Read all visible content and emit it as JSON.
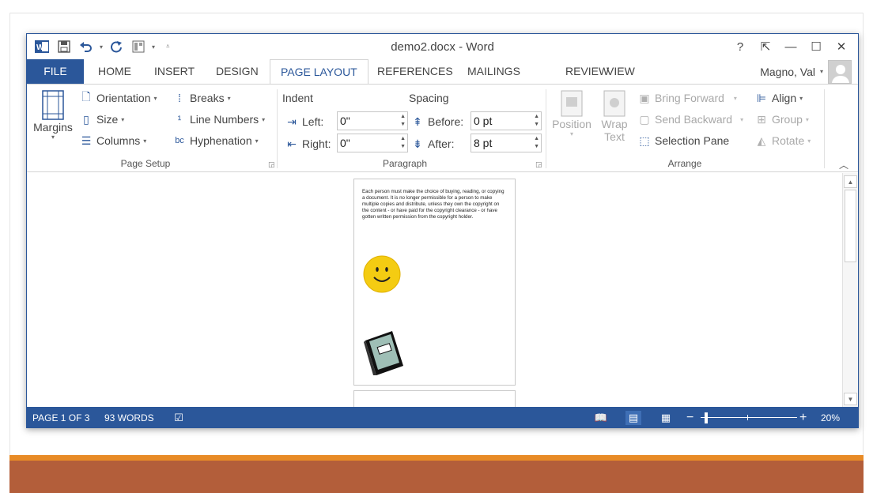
{
  "window": {
    "title": "demo2.docx - Word",
    "help": "?",
    "restore_ribbon": "⇱",
    "minimize": "—",
    "maximize": "☐",
    "close": "✕"
  },
  "qat": {
    "app_icon": "word-app-icon",
    "save": "save-icon",
    "undo": "undo-icon",
    "redo": "redo-icon",
    "customize": "customize-qat-icon"
  },
  "tabs": [
    {
      "label": "FILE"
    },
    {
      "label": "HOME"
    },
    {
      "label": "INSERT"
    },
    {
      "label": "DESIGN"
    },
    {
      "label": "PAGE LAYOUT"
    },
    {
      "label": "REFERENCES"
    },
    {
      "label": "MAILINGS"
    },
    {
      "label": "REVIEW"
    },
    {
      "label": "VIEW"
    }
  ],
  "active_tab": "PAGE LAYOUT",
  "user": {
    "name": "Magno, Val"
  },
  "ribbon": {
    "page_setup": {
      "label": "Page Setup",
      "margins": "Margins",
      "orientation": "Orientation",
      "size": "Size",
      "columns": "Columns",
      "breaks": "Breaks",
      "line_numbers": "Line Numbers",
      "hyphenation": "Hyphenation"
    },
    "paragraph": {
      "label": "Paragraph",
      "indent": "Indent",
      "spacing": "Spacing",
      "left_label": "Left:",
      "left_value": "0\"",
      "right_label": "Right:",
      "right_value": "0\"",
      "before_label": "Before:",
      "before_value": "0 pt",
      "after_label": "After:",
      "after_value": "8 pt"
    },
    "arrange": {
      "label": "Arrange",
      "position": "Position",
      "wrap_text_1": "Wrap",
      "wrap_text_2": "Text",
      "bring_forward": "Bring Forward",
      "send_backward": "Send Backward",
      "selection_pane": "Selection Pane",
      "align": "Align",
      "group": "Group",
      "rotate": "Rotate"
    }
  },
  "document": {
    "page1_text": "Each person must make the choice of buying, reading, or copying a document. It is no longer permissible for a person to make multiple copies and distribute, unless they own the copyright on the content - or have paid for the copyright clearance - or have gotten written permission from the copyright holder.",
    "images": [
      "smiley-face-clipart",
      "law-book-clipart"
    ]
  },
  "status": {
    "page": "PAGE 1 OF 3",
    "words": "93 WORDS",
    "zoom": "20%",
    "zoom_level": 0.2
  },
  "colors": {
    "accent": "#2b579a",
    "slide_orange": "#e88b26",
    "slide_rust": "#b35e3a"
  }
}
